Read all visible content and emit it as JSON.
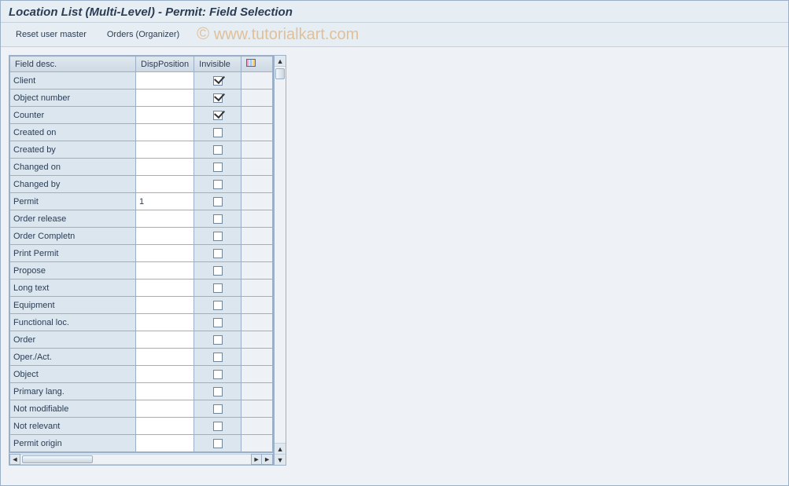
{
  "title": "Location List (Multi-Level) - Permit: Field Selection",
  "toolbar": {
    "reset_label": "Reset user master",
    "orders_label": "Orders (Organizer)"
  },
  "columns": {
    "field_desc": "Field desc.",
    "disp_position": "DispPosition",
    "invisible": "Invisible"
  },
  "rows": [
    {
      "desc": "Client",
      "disp": "",
      "invisible": true
    },
    {
      "desc": "Object number",
      "disp": "",
      "invisible": true
    },
    {
      "desc": "Counter",
      "disp": "",
      "invisible": true
    },
    {
      "desc": "Created on",
      "disp": "",
      "invisible": false
    },
    {
      "desc": "Created by",
      "disp": "",
      "invisible": false
    },
    {
      "desc": "Changed on",
      "disp": "",
      "invisible": false
    },
    {
      "desc": "Changed by",
      "disp": "",
      "invisible": false
    },
    {
      "desc": "Permit",
      "disp": "1",
      "invisible": false
    },
    {
      "desc": "Order release",
      "disp": "",
      "invisible": false
    },
    {
      "desc": "Order Completn",
      "disp": "",
      "invisible": false
    },
    {
      "desc": "Print Permit",
      "disp": "",
      "invisible": false
    },
    {
      "desc": "Propose",
      "disp": "",
      "invisible": false
    },
    {
      "desc": "Long text",
      "disp": "",
      "invisible": false
    },
    {
      "desc": "Equipment",
      "disp": "",
      "invisible": false
    },
    {
      "desc": "Functional loc.",
      "disp": "",
      "invisible": false
    },
    {
      "desc": "Order",
      "disp": "",
      "invisible": false
    },
    {
      "desc": "Oper./Act.",
      "disp": "",
      "invisible": false
    },
    {
      "desc": "Object",
      "disp": "",
      "invisible": false
    },
    {
      "desc": "Primary lang.",
      "disp": "",
      "invisible": false
    },
    {
      "desc": "Not modifiable",
      "disp": "",
      "invisible": false
    },
    {
      "desc": "Not relevant",
      "disp": "",
      "invisible": false
    },
    {
      "desc": "Permit origin",
      "disp": "",
      "invisible": false
    }
  ],
  "watermark": "© www.tutorialkart.com"
}
